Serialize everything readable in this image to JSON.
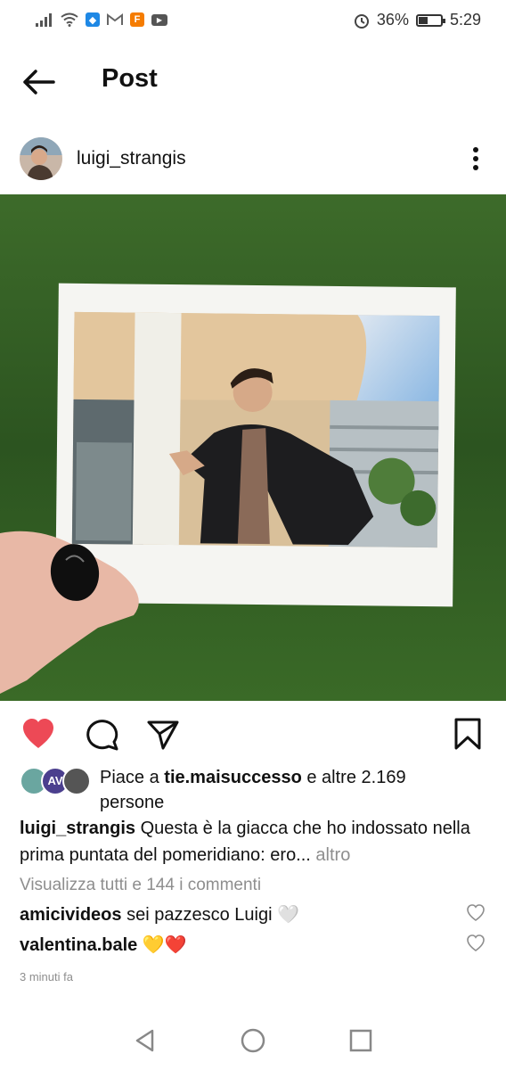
{
  "status_bar": {
    "battery": "36%",
    "time": "5:29",
    "app_icons": [
      "signal-icon",
      "wifi-icon",
      "shield-app-icon",
      "gmail-icon",
      "fan-app-icon",
      "youtube-icon"
    ]
  },
  "header": {
    "title": "Post"
  },
  "post": {
    "username": "luigi_strangis",
    "image_icon": "polaroid-photo",
    "likes_prefix": "Piace a",
    "likes_user": "tie.maisuccesso",
    "likes_suffix": "e altre 2.169 persone",
    "caption_user": "luigi_strangis",
    "caption_text": "Questa è la giacca che ho indossato nella prima puntata del pomeridiano: ero...",
    "caption_more": "altro",
    "view_comments": "Visualizza tutti e 144 i commenti",
    "comments": [
      {
        "user": "amicivideos",
        "text": "sei pazzesco Luigi 🤍"
      },
      {
        "user": "valentina.bale",
        "text": "💛❤️"
      }
    ],
    "timestamp": "3 minuti fa"
  },
  "colors": {
    "like_red": "#ed4956",
    "secondary_text": "#8e8e8e",
    "grass_green": "#2e5a1f"
  }
}
